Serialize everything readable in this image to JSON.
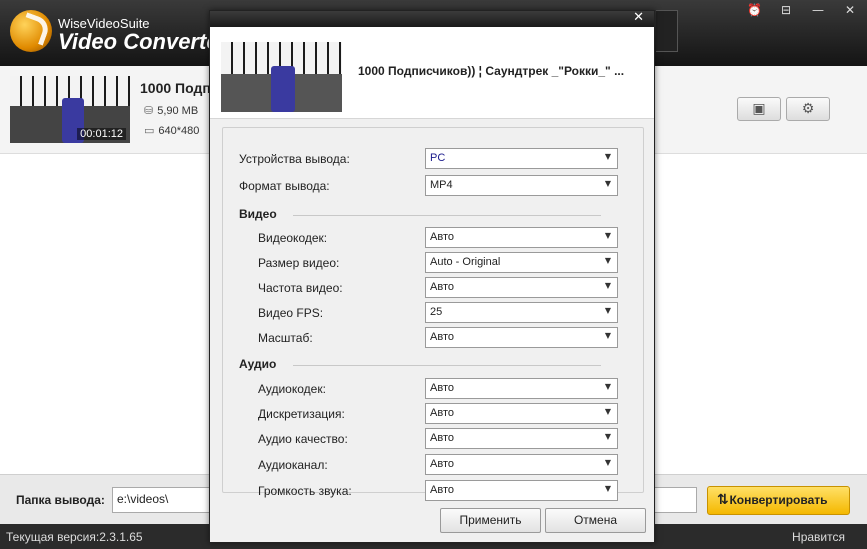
{
  "app": {
    "brand": "WiseVideoSuite",
    "product": "Video Converter",
    "window_controls": [
      "⏰",
      "⊟",
      "—",
      "✕"
    ]
  },
  "file": {
    "title": "1000 Подп",
    "size": "5,90 MB",
    "resolution": "640*480",
    "duration": "00:01:12"
  },
  "footer": {
    "output_label": "Папка вывода:",
    "output_path": "e:\\videos\\",
    "convert_label": "Конвертировать"
  },
  "status": {
    "version": "Текущая версия:2.3.1.65",
    "like": "Нравится"
  },
  "dialog": {
    "close": "✕",
    "title": "1000 Подписчиков)) ¦ Саундтрек _\"Рокки_\" ...",
    "output_device_label": "Устройства вывода:",
    "output_device_value": "PC",
    "output_format_label": "Формат вывода:",
    "output_format_value": "MP4",
    "video_section": "Видео",
    "video": [
      {
        "label": "Видеокодек:",
        "value": "Авто"
      },
      {
        "label": "Размер видео:",
        "value": "Auto - Original"
      },
      {
        "label": "Частота видео:",
        "value": "Авто"
      },
      {
        "label": "Видео FPS:",
        "value": "25"
      },
      {
        "label": "Масштаб:",
        "value": "Авто"
      }
    ],
    "audio_section": "Аудио",
    "audio": [
      {
        "label": "Аудиокодек:",
        "value": "Авто"
      },
      {
        "label": "Дискретизация:",
        "value": "Авто"
      },
      {
        "label": "Аудио качество:",
        "value": "Авто"
      },
      {
        "label": "Аудиоканал:",
        "value": "Авто"
      },
      {
        "label": "Громкость звука:",
        "value": "Авто"
      }
    ],
    "apply_label": "Применить",
    "cancel_label": "Отмена"
  },
  "colors": {
    "accent": "#f4b800",
    "titlebar": "#1a1a1a",
    "select_highlight": "#1a1a8c"
  }
}
